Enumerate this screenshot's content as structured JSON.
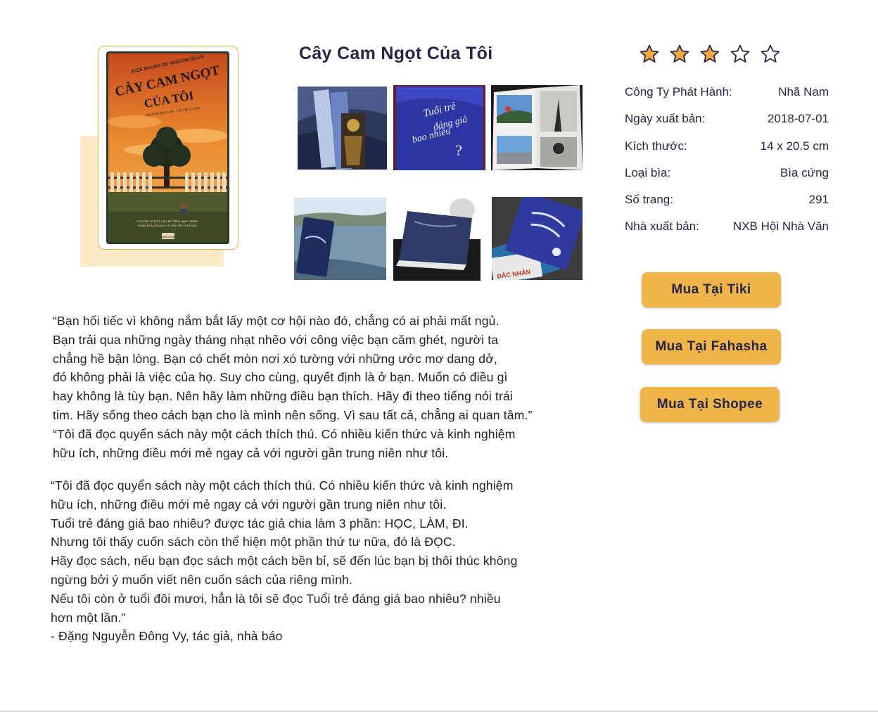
{
  "book": {
    "title": "Cây Cam Ngọt Của Tôi",
    "cover": {
      "author": "JOSÉ MAURO DE VASCONCELOS",
      "title_line1": "CÂY CAM NGỌT",
      "title_line2": "CỦA TÔI",
      "translators": "NGUYỄN BÍCH LAN · TÔ YẾN LY dịch",
      "tagline_line1": "CHUYỆN VỀ MỘT CẬU BÉ TRÊN HÀNH TRÌNH",
      "tagline_line2": "KHÁM PHÁ NỖI ĐAU VÀ TÌNH YÊU THƯƠNG",
      "publisher_mark": "NHÃ NAM"
    },
    "gallery": [
      {
        "name": "photo-bookmark"
      },
      {
        "name": "photo-blue-cover"
      },
      {
        "name": "photo-open-book"
      },
      {
        "name": "photo-held-book"
      },
      {
        "name": "photo-book-angle"
      },
      {
        "name": "photo-book-stack"
      }
    ],
    "rating": {
      "value": 3,
      "max": 5,
      "filled_color": "#f4a93e",
      "outline_color": "#262648"
    },
    "details": [
      {
        "label": "Công Ty Phát Hành:",
        "value": "Nhã Nam"
      },
      {
        "label": "Ngày xuất bản:",
        "value": "2018-07-01"
      },
      {
        "label": "Kích thước:",
        "value": "14 x 20.5 cm"
      },
      {
        "label": "Loại bìa:",
        "value": "Bìa cứng"
      },
      {
        "label": "Số trang:",
        "value": "291"
      },
      {
        "label": "Nhà xuất bản:",
        "value": "NXB Hội Nhà Văn"
      }
    ]
  },
  "buy": {
    "tiki": "Mua Tại Tiki",
    "fahasha": "Mua Tại Fahasha",
    "shopee": "Mua Tại Shopee",
    "button_color": "#f0b549"
  },
  "description": {
    "quote1_lines": [
      "“Bạn hối tiếc vì không nắm bắt lấy một cơ hội nào đó, chẳng có ai phải mất ngủ.",
      "Bạn trải qua những ngày tháng nhạt nhẽo với công việc bạn căm ghét, người ta",
      "chẳng hề bận lòng. Bạn có chết mòn nơi xó tường với những ước mơ dang dở,",
      "đó không phải là việc của họ. Suy cho cùng, quyết định là ở bạn. Muốn có điều gì",
      "hay không là tùy bạn. Nên hãy làm những điều bạn thích. Hãy đi theo tiếng nói trái",
      "tim. Hãy sống theo cách bạn cho là mình nên sống. Vì sau tất cả, chẳng ai quan tâm.”",
      "“Tôi đã đọc quyển sách này một cách thích thú. Có nhiều kiến thức và kinh nghiệm",
      "hữu ích, những điều mới mẻ ngay cả với người gần trung niên như tôi."
    ],
    "quote2_lines": [
      "“Tôi đã đọc quyển sách này một cách thích thú. Có nhiều kiến thức và kinh nghiệm",
      "hữu ích, những điều mới mẻ ngay cả với người gần trung niên như tôi.",
      "Tuổi trẻ đáng giá bao nhiêu? được tác giả chia làm 3 phần: HỌC, LÀM, ĐI.",
      "Nhưng tôi thấy cuốn sách còn thể hiện một phần thứ tư nữa, đó là ĐỌC.",
      "Hãy đọc sách, nếu bạn đọc sách một cách bền bỉ, sẽ đến lúc bạn bị thôi thúc không",
      "ngừng bởi ý muốn viết nên cuốn sách của riêng mình.",
      "Nếu tôi còn ở tuổi đôi mươi, hẳn là tôi sẽ đọc Tuổi trẻ đáng giá bao nhiêu? nhiều",
      "hơn một lần.”",
      "- Đặng Nguyễn Đông Vy, tác giả, nhà báo"
    ]
  },
  "photo_text": {
    "blue_cover_line1": "Tuổi trẻ",
    "blue_cover_line2": "đáng giá",
    "blue_cover_line3": "bao nhiêu",
    "stack_spine": "ĐẮC NHÂN"
  }
}
